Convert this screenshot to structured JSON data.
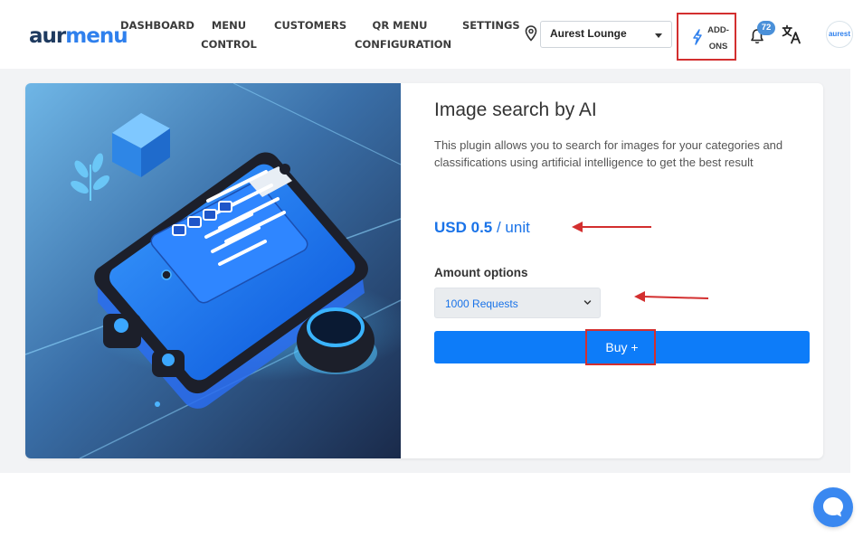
{
  "logo": {
    "part1": "aur",
    "part2": "menu"
  },
  "nav": {
    "dashboard": "DASHBOARD",
    "menu_line1": "MENU",
    "menu_line2": "CONTROL",
    "customers": "CUSTOMERS",
    "qr_line1": "QR MENU",
    "qr_line2": "CONFIGURATION",
    "settings": "SETTINGS"
  },
  "branch_select": {
    "value": "Aurest Lounge"
  },
  "addons": {
    "line1": "ADD-",
    "line2": "ONS"
  },
  "notifications": {
    "count": "72"
  },
  "avatar": {
    "text": "aurest"
  },
  "plugin": {
    "title": "Image search by AI",
    "description": "This plugin allows you to search for images for your categories and classifications using artificial intelligence to get the best result",
    "price_amount": "USD 0.5",
    "price_unit": "/ unit",
    "amount_label": "Amount options",
    "amount_selected": "1000 Requests",
    "buy_label": "Buy +"
  },
  "colors": {
    "accent": "#0d7cf9",
    "price": "#1a73e8",
    "highlight": "#d32f2f",
    "badge": "#4a90d9"
  },
  "icons": {
    "location": "map-pin-icon",
    "bolt": "lightning-icon",
    "bell": "bell-icon",
    "translate": "translate-icon",
    "chat": "chat-icon"
  }
}
